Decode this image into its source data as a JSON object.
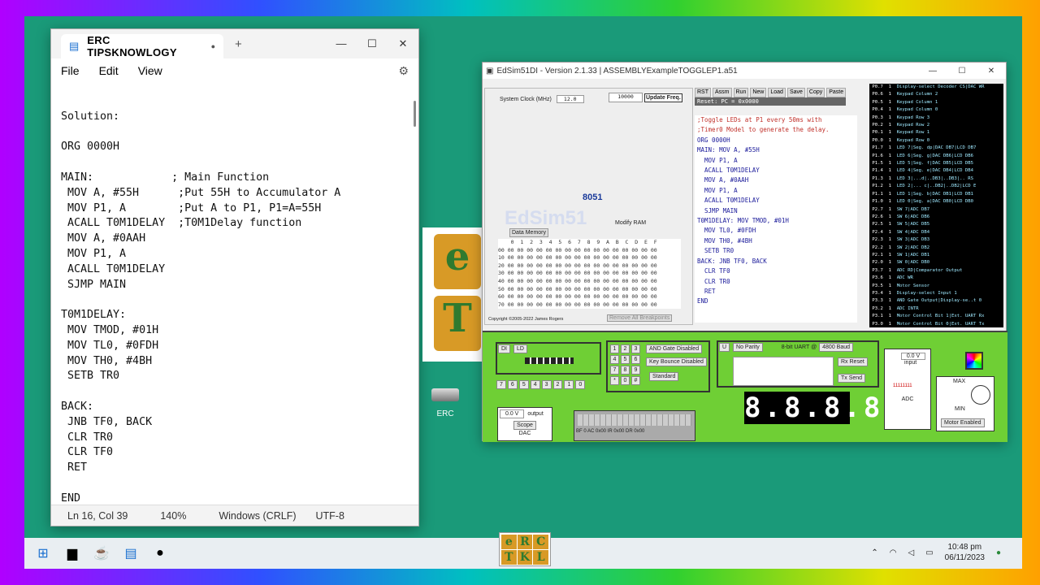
{
  "notepad": {
    "tab_title": "ERC TIPSKNOWLOGY",
    "tab_modified": "●",
    "new_tab": "+",
    "menu": [
      "File",
      "Edit",
      "View"
    ],
    "lines": [
      "",
      "Solution:",
      "",
      "ORG 0000H",
      "",
      "MAIN:            ; Main Function",
      " MOV A, #55H      ;Put 55H to Accumulator A",
      " MOV P1, A        ;Put A to P1, P1=A=55H",
      " ACALL T0M1DELAY  ;T0M1Delay function",
      " MOV A, #0AAH",
      " MOV P1, A",
      " ACALL T0M1DELAY",
      " SJMP MAIN",
      "",
      "T0M1DELAY:",
      " MOV TMOD, #01H",
      " MOV TL0, #0FDH",
      " MOV TH0, #4BH",
      " SETB TR0",
      "",
      "BACK:",
      " JNB TF0, BACK",
      " CLR TR0",
      " CLR TF0",
      " RET",
      "",
      "END"
    ],
    "status": {
      "position": "Ln 16, Col 39",
      "zoom": "140%",
      "line_ending": "Windows (CRLF)",
      "encoding": "UTF-8"
    }
  },
  "desktop": {
    "drive_label": "ERC"
  },
  "edsim": {
    "title": "EdSim51DI - Version 2.1.33 | ASSEMBLYExampleTOGGLEP1.a51",
    "clock_label": "System Clock (MHz)",
    "clock_value": "12.0",
    "speed": "10000",
    "update_freq": "Update Freq.",
    "toolbar": [
      "RST",
      "Assm",
      "Run",
      "New",
      "Load",
      "Save",
      "Copy",
      "Paste"
    ],
    "reset_text": "Reset: PC = 0x0000",
    "chip": "8051",
    "watermark": "EdSim51",
    "data_memory": "Data Memory",
    "modify_ram": "Modify RAM",
    "remove_breakpoints": "Remove All Breakpoints",
    "copyright": "Copyright ©2005-2022 James Rogers",
    "code": [
      ";Toggle LEDs at P1 every 50ms with",
      ";Timer0 Model to generate the delay.",
      "ORG 0000H",
      "MAIN: MOV A, #55H",
      "  MOV P1, A",
      "  ACALL T0M1DELAY",
      "  MOV A, #0AAH",
      "  MOV P1, A",
      "  ACALL T0M1DELAY",
      "  SJMP MAIN",
      "T0M1DELAY: MOV TMOD, #01H",
      "  MOV TL0, #0FDH",
      "  MOV TH0, #4BH",
      "  SETB TR0",
      "BACK: JNB TF0, BACK",
      "  CLR TF0",
      "  CLR TR0",
      "  RET",
      "END"
    ],
    "pins": [
      [
        "P0.7",
        "Display-select Decoder CS|DAC WR"
      ],
      [
        "P0.6",
        "Keypad Column 2"
      ],
      [
        "P0.5",
        "Keypad Column 1"
      ],
      [
        "P0.4",
        "Keypad Column 0"
      ],
      [
        "P0.3",
        "Keypad Row 3"
      ],
      [
        "P0.2",
        "Keypad Row 2"
      ],
      [
        "P0.1",
        "Keypad Row 1"
      ],
      [
        "P0.0",
        "Keypad Row 0"
      ],
      [
        "P1.7",
        "LED 7|Seg. dp|DAC DB7|LCD DB7"
      ],
      [
        "P1.6",
        "LED 6|Seg. g|DAC DB6|LCD DB6"
      ],
      [
        "P1.5",
        "LED 5|Seg. f|DAC DB5|LCD DB5"
      ],
      [
        "P1.4",
        "LED 4|Seg. e|DAC DB4|LCD DB4"
      ],
      [
        "P1.3",
        "LED 3|...d|..DB3|..DB3|.. RS"
      ],
      [
        "P1.2",
        "LED 2|... c|..DB2|..DB2|LCD E"
      ],
      [
        "P1.1",
        "LED 1|Seg. b|DAC DB1|LCD DB1"
      ],
      [
        "P1.0",
        "LED 0|Seg. a|DAC DB0|LCD DB0"
      ],
      [
        "P2.7",
        "SW 7|ADC DB7"
      ],
      [
        "P2.6",
        "SW 6|ADC DB6"
      ],
      [
        "P2.5",
        "SW 5|ADC DB5"
      ],
      [
        "P2.4",
        "SW 4|ADC DB4"
      ],
      [
        "P2.3",
        "SW 3|ADC DB3"
      ],
      [
        "P2.2",
        "SW 2|ADC DB2"
      ],
      [
        "P2.1",
        "SW 1|ADC DB1"
      ],
      [
        "P2.0",
        "SW 0|ADC DB0"
      ],
      [
        "P3.7",
        "ADC RD|Comparator Output"
      ],
      [
        "P3.6",
        "ADC WR"
      ],
      [
        "P3.5",
        "Motor Sensor"
      ],
      [
        "P3.4",
        "Display-select Input 1"
      ],
      [
        "P3.3",
        "AND Gate Output|Display-se..t 0"
      ],
      [
        "P3.2",
        "ADC INTR"
      ],
      [
        "P3.1",
        "Motor Control Bit 1|Ext. UART Rx"
      ],
      [
        "P3.0",
        "Motor Control Bit 0|Ext. UART Tx"
      ]
    ],
    "periph": {
      "and_gate": "AND Gate Disabled",
      "key_bounce": "Key Bounce Disabled",
      "standard": "Standard",
      "parity": "No Parity",
      "uart": "8-bit UART @",
      "baud": "4800 Baud",
      "rx_reset": "Rx Reset",
      "tx_send": "Tx Send",
      "dac_value": "0.0 V",
      "dac_output": "output",
      "scope": "Scope",
      "dac": "DAC",
      "adc_value": "0.0 V",
      "adc_input": "input",
      "adc_bits": "11111111",
      "adc": "ADC",
      "max": "MAX",
      "min": "MIN",
      "motor": "Motor Enabled",
      "seg_display": "8.8.8.8",
      "switches": [
        "7",
        "6",
        "5",
        "4",
        "3",
        "2",
        "1",
        "0"
      ],
      "keypad": [
        "1",
        "2",
        "3",
        "4",
        "5",
        "6",
        "7",
        "8",
        "9",
        "*",
        "0",
        "#"
      ],
      "lcd_regs": "BF 0  AC 0x00  IR 0x00  DR 0x00"
    }
  },
  "taskbar": {
    "time": "10:48 pm",
    "date": "06/11/2023",
    "erc_logo": [
      "e",
      "R",
      "C",
      "T",
      "K",
      "L"
    ]
  }
}
